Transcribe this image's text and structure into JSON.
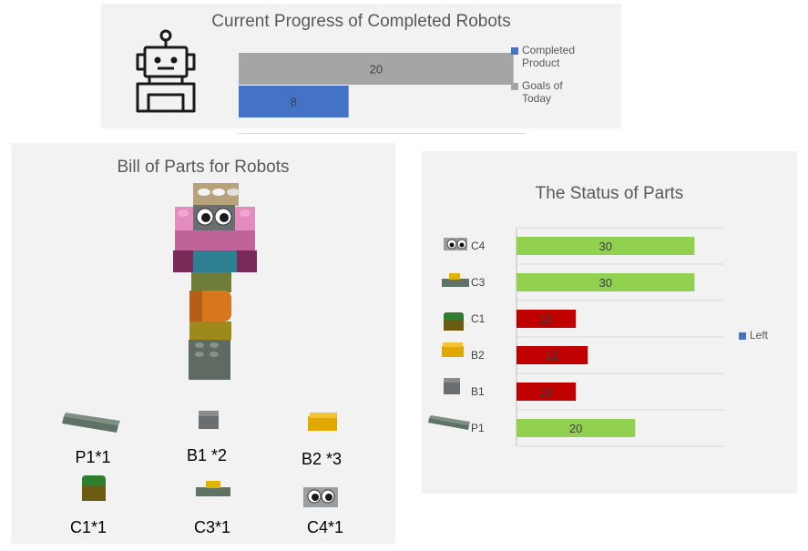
{
  "colors": {
    "completed": "#4472c4",
    "goal": "#a5a5a5",
    "ok": "#92d050",
    "low": "#c00000",
    "legend_left": "#4472c4"
  },
  "progress": {
    "title": "Current Progress of Completed Robots",
    "icon": "robot-icon",
    "legend": [
      {
        "label_line1": "Completed",
        "label_line2": "Product"
      },
      {
        "label_line1": "Goals of",
        "label_line2": "Today"
      }
    ]
  },
  "bom": {
    "title": "Bill of Parts for  Robots",
    "parts": [
      {
        "label": "P1*1",
        "icon": "long-gray-plate-icon"
      },
      {
        "label": "B1 *2",
        "icon": "gray-brick-icon"
      },
      {
        "label": "B2 *3",
        "icon": "yellow-brick-icon"
      },
      {
        "label": "C1*1",
        "icon": "green-slope-brick-icon"
      },
      {
        "label": "C3*1",
        "icon": "gray-yellow-plate-icon"
      },
      {
        "label": "C4*1",
        "icon": "eyes-brick-icon"
      }
    ]
  },
  "status": {
    "title": "The Status of Parts",
    "legend_label": "Left"
  },
  "chart_data": [
    {
      "type": "bar",
      "orientation": "horizontal",
      "title": "Current Progress of Completed Robots",
      "categories": [
        "Goals of Today",
        "Completed Product"
      ],
      "series": [
        {
          "name": "Goals of Today",
          "values": [
            20
          ]
        },
        {
          "name": "Completed Product",
          "values": [
            8
          ]
        }
      ],
      "xlim": [
        0,
        24
      ]
    },
    {
      "type": "bar",
      "orientation": "horizontal",
      "title": "The Status of Parts",
      "categories": [
        "C4",
        "C3",
        "C1",
        "B2",
        "B1",
        "P1"
      ],
      "series": [
        {
          "name": "Left",
          "values": [
            30,
            30,
            10,
            12,
            10,
            20
          ]
        }
      ],
      "value_labels": [
        "30",
        "30",
        "10",
        "12",
        "10",
        "20"
      ],
      "bar_colors": [
        "ok",
        "ok",
        "low",
        "low",
        "low",
        "ok"
      ],
      "xlim": [
        0,
        35
      ],
      "grid": true,
      "legend_position": "right"
    }
  ]
}
